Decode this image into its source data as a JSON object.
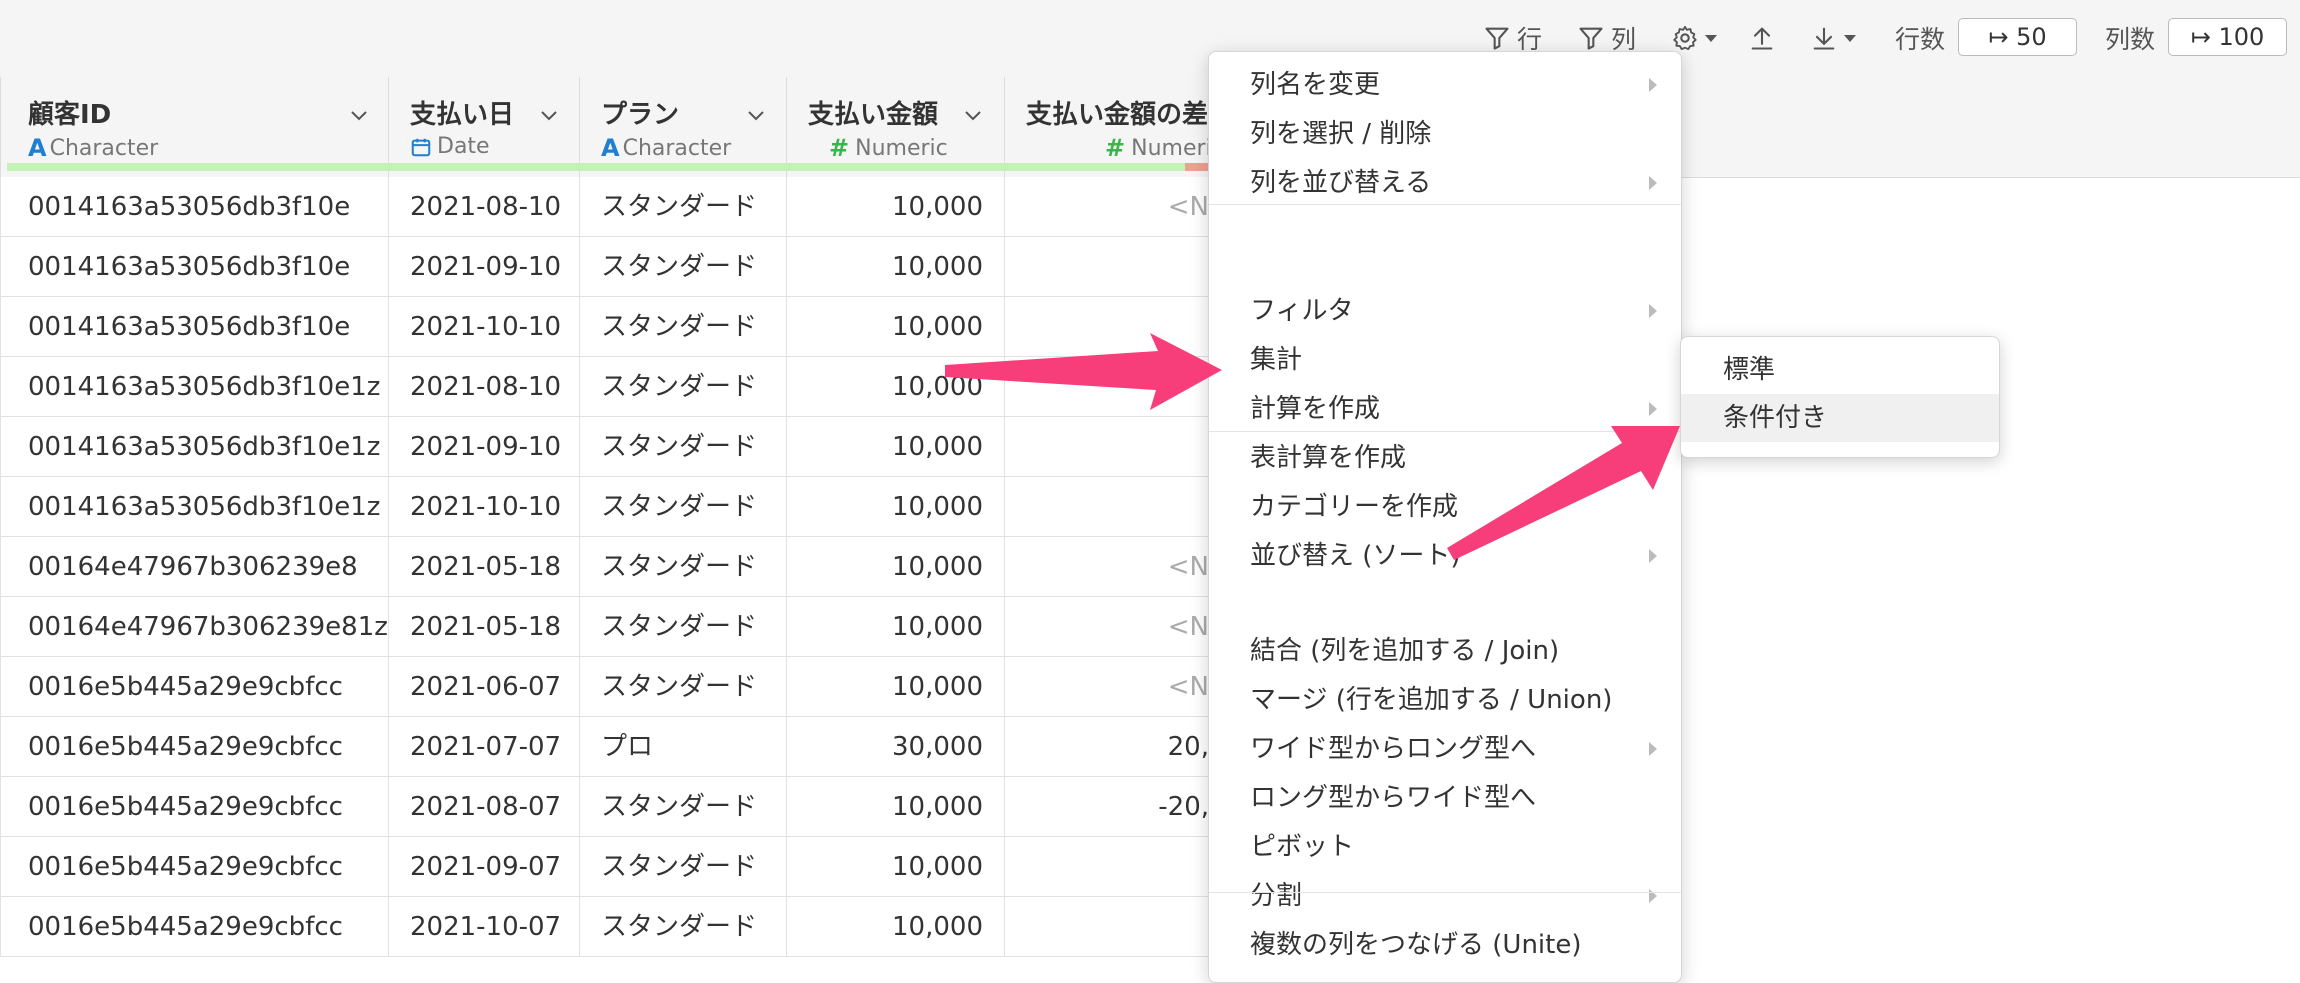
{
  "toolbar": {
    "filter_row_label": "行",
    "filter_col_label": "列",
    "row_count_label": "行数",
    "row_count_value": "↦ 50",
    "col_count_label": "列数",
    "col_count_value": "↦ 100"
  },
  "columns": [
    {
      "name": "顧客ID",
      "type": "Character"
    },
    {
      "name": "支払い日",
      "type": "Date"
    },
    {
      "name": "プラン",
      "type": "Character"
    },
    {
      "name": "支払い金額",
      "type": "Numeric"
    },
    {
      "name": "支払い金額の差",
      "type": "Numeri"
    }
  ],
  "rows": [
    {
      "id": "0014163a53056db3f10e",
      "date": "2021-08-10",
      "plan": "スタンダード",
      "amount": "10,000",
      "diff": "<N"
    },
    {
      "id": "0014163a53056db3f10e",
      "date": "2021-09-10",
      "plan": "スタンダード",
      "amount": "10,000",
      "diff": ""
    },
    {
      "id": "0014163a53056db3f10e",
      "date": "2021-10-10",
      "plan": "スタンダード",
      "amount": "10,000",
      "diff": ""
    },
    {
      "id": "0014163a53056db3f10e1z",
      "date": "2021-08-10",
      "plan": "スタンダード",
      "amount": "10,000",
      "diff": ""
    },
    {
      "id": "0014163a53056db3f10e1z",
      "date": "2021-09-10",
      "plan": "スタンダード",
      "amount": "10,000",
      "diff": ""
    },
    {
      "id": "0014163a53056db3f10e1z",
      "date": "2021-10-10",
      "plan": "スタンダード",
      "amount": "10,000",
      "diff": ""
    },
    {
      "id": "00164e47967b306239e8",
      "date": "2021-05-18",
      "plan": "スタンダード",
      "amount": "10,000",
      "diff": "<N"
    },
    {
      "id": "00164e47967b306239e81z",
      "date": "2021-05-18",
      "plan": "スタンダード",
      "amount": "10,000",
      "diff": "<N"
    },
    {
      "id": "0016e5b445a29e9cbfcc",
      "date": "2021-06-07",
      "plan": "スタンダード",
      "amount": "10,000",
      "diff": "<N"
    },
    {
      "id": "0016e5b445a29e9cbfcc",
      "date": "2021-07-07",
      "plan": "プロ",
      "amount": "30,000",
      "diff": "20,"
    },
    {
      "id": "0016e5b445a29e9cbfcc",
      "date": "2021-08-07",
      "plan": "スタンダード",
      "amount": "10,000",
      "diff": "-20,"
    },
    {
      "id": "0016e5b445a29e9cbfcc",
      "date": "2021-09-07",
      "plan": "スタンダード",
      "amount": "10,000",
      "diff": ""
    },
    {
      "id": "0016e5b445a29e9cbfcc",
      "date": "2021-10-07",
      "plan": "スタンダード",
      "amount": "10,000",
      "diff": ""
    }
  ],
  "menu": {
    "items": [
      {
        "label": "列名を変更",
        "submenu": true
      },
      {
        "label": "列を選択 / 削除",
        "submenu": false
      },
      {
        "label": "列を並び替える",
        "submenu": true
      },
      {
        "label": "フィルタ",
        "submenu": true
      },
      {
        "label": "集計",
        "submenu": false
      },
      {
        "label": "計算を作成",
        "submenu": true
      },
      {
        "label": "表計算を作成",
        "submenu": true
      },
      {
        "label": "カテゴリーを作成",
        "submenu": false
      },
      {
        "label": "並び替え (ソート)",
        "submenu": true
      },
      {
        "label": "結合 (列を追加する / Join)",
        "submenu": false
      },
      {
        "label": "マージ (行を追加する / Union)",
        "submenu": false
      },
      {
        "label": "ワイド型からロング型へ",
        "submenu": true
      },
      {
        "label": "ロング型からワイド型へ",
        "submenu": false
      },
      {
        "label": "ピボット",
        "submenu": false
      },
      {
        "label": "分割",
        "submenu": true
      },
      {
        "label": "複数の列をつなげる (Unite)",
        "submenu": false
      }
    ]
  },
  "submenu": {
    "items": [
      {
        "label": "標準"
      },
      {
        "label": "条件付き"
      }
    ]
  },
  "colors": {
    "accent_arrow": "#f73d7a",
    "type_character": "#1f7fd1",
    "type_numeric": "#39b54a",
    "quality_ok": "#c4f2b6",
    "quality_na": "#f0a090"
  }
}
